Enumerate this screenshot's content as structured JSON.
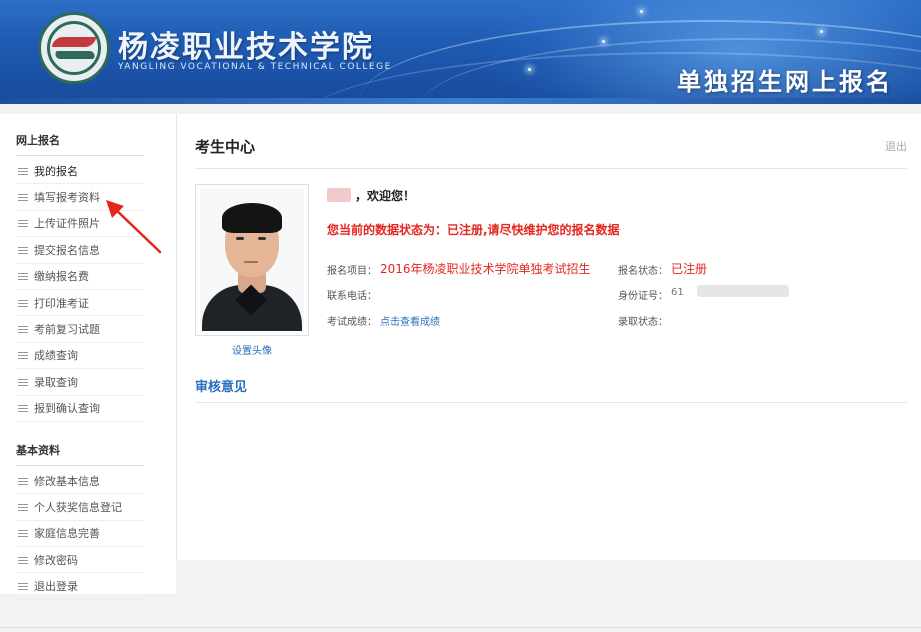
{
  "header": {
    "school_cn": "杨凌职业技术学院",
    "school_en": "YANGLING VOCATIONAL & TECHNICAL COLLEGE",
    "portal_title": "单独招生网上报名"
  },
  "sidebar": {
    "groups": [
      {
        "title": "网上报名",
        "items": [
          {
            "label": "我的报名"
          },
          {
            "label": "填写报考资料"
          },
          {
            "label": "上传证件照片"
          },
          {
            "label": "提交报名信息"
          },
          {
            "label": "缴纳报名费"
          },
          {
            "label": "打印准考证"
          },
          {
            "label": "考前复习试题"
          },
          {
            "label": "成绩查询"
          },
          {
            "label": "录取查询"
          },
          {
            "label": "报到确认查询"
          }
        ]
      },
      {
        "title": "基本资料",
        "items": [
          {
            "label": "修改基本信息"
          },
          {
            "label": "个人获奖信息登记"
          },
          {
            "label": "家庭信息完善"
          },
          {
            "label": "修改密码"
          },
          {
            "label": "退出登录"
          }
        ]
      }
    ]
  },
  "main": {
    "title": "考生中心",
    "logout": "退出",
    "set_avatar": "设置头像",
    "welcome": "，欢迎您！",
    "status_message": "您当前的数据状态为：已注册,请尽快维护您的报名数据",
    "fields": {
      "project_label": "报名项目：",
      "project_value": "2016年杨凌职业技术学院单独考试招生",
      "status_label": "报名状态：",
      "status_value": "已注册",
      "phone_label": "联系电话：",
      "id_label": "身份证号：",
      "id_value": "61",
      "score_label": "考试成绩：",
      "score_link": "点击查看成绩",
      "admission_label": "录取状态："
    },
    "review_title": "审核意见"
  },
  "colors": {
    "accent_red": "#e5261f",
    "link_blue": "#2a6fbf",
    "banner_blue": "#1f5bb3"
  }
}
